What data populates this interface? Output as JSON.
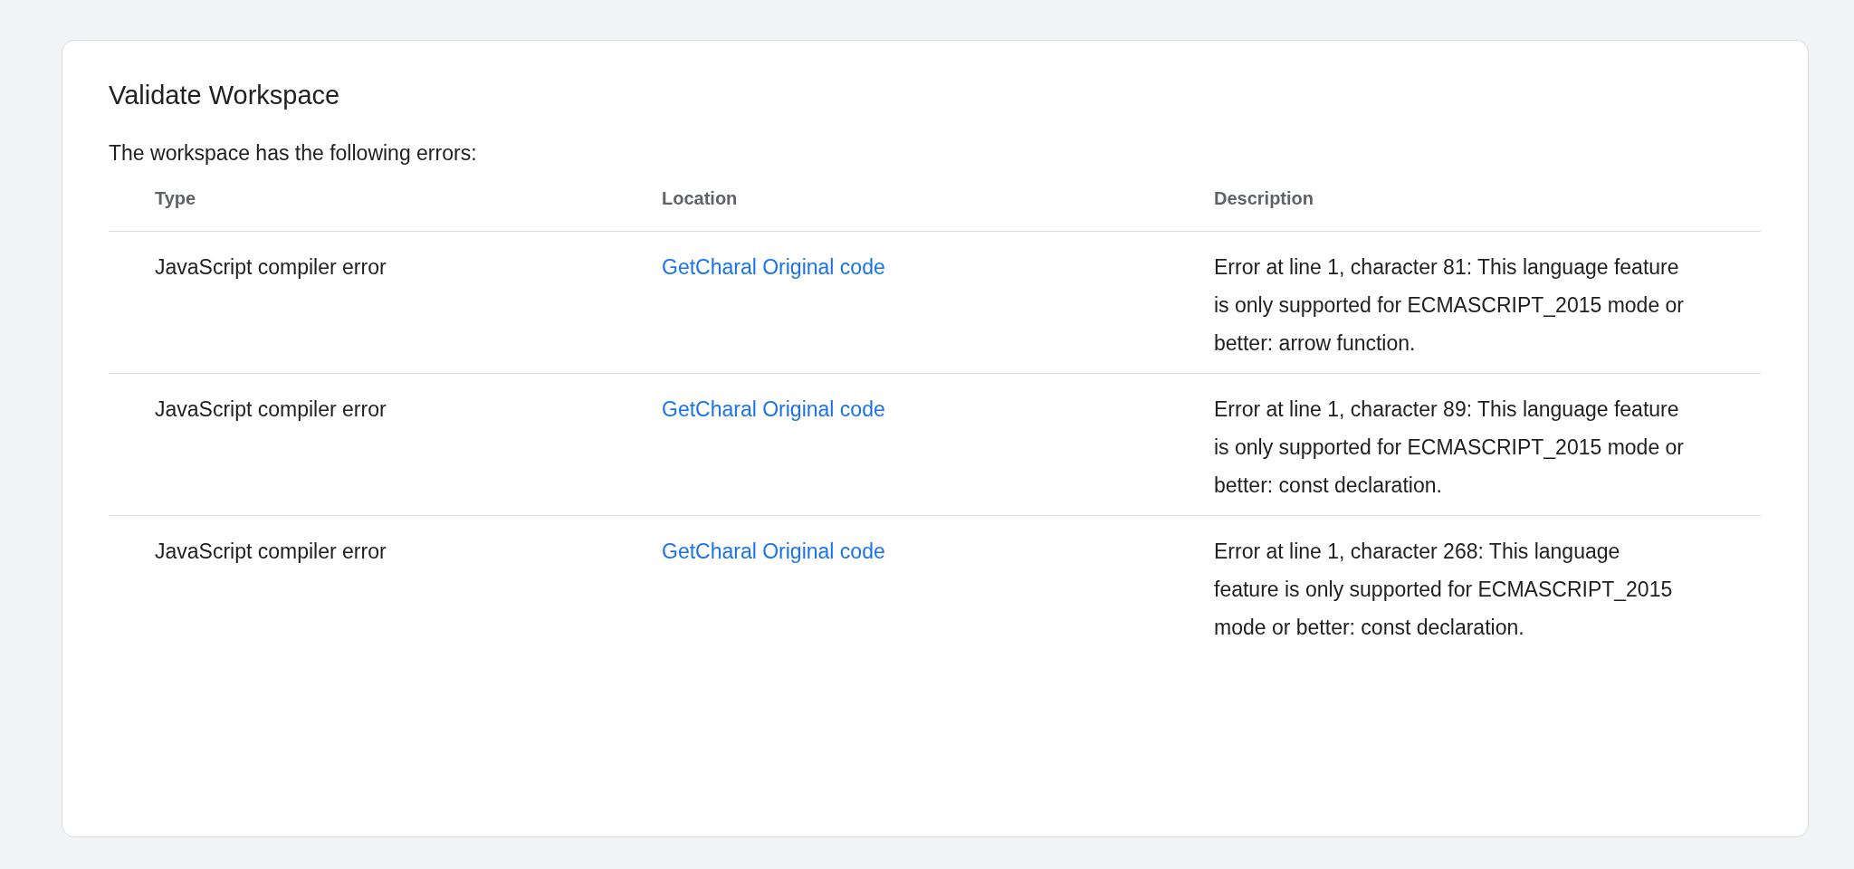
{
  "title": "Validate Workspace",
  "subtitle": "The workspace has the following errors:",
  "table": {
    "columns": [
      "Type",
      "Location",
      "Description"
    ],
    "rows": [
      {
        "type": "JavaScript compiler error",
        "location": "GetCharal Original code",
        "description": "Error at line 1, character 81: This language feature is only supported for ECMASCRIPT_2015 mode or better: arrow function."
      },
      {
        "type": "JavaScript compiler error",
        "location": "GetCharal Original code",
        "description": "Error at line 1, character 89: This language feature is only supported for ECMASCRIPT_2015 mode or better: const declaration."
      },
      {
        "type": "JavaScript compiler error",
        "location": "GetCharal Original code",
        "description": "Error at line 1, character 268: This language feature is only supported for ECMASCRIPT_2015 mode or better: const declaration."
      }
    ]
  }
}
